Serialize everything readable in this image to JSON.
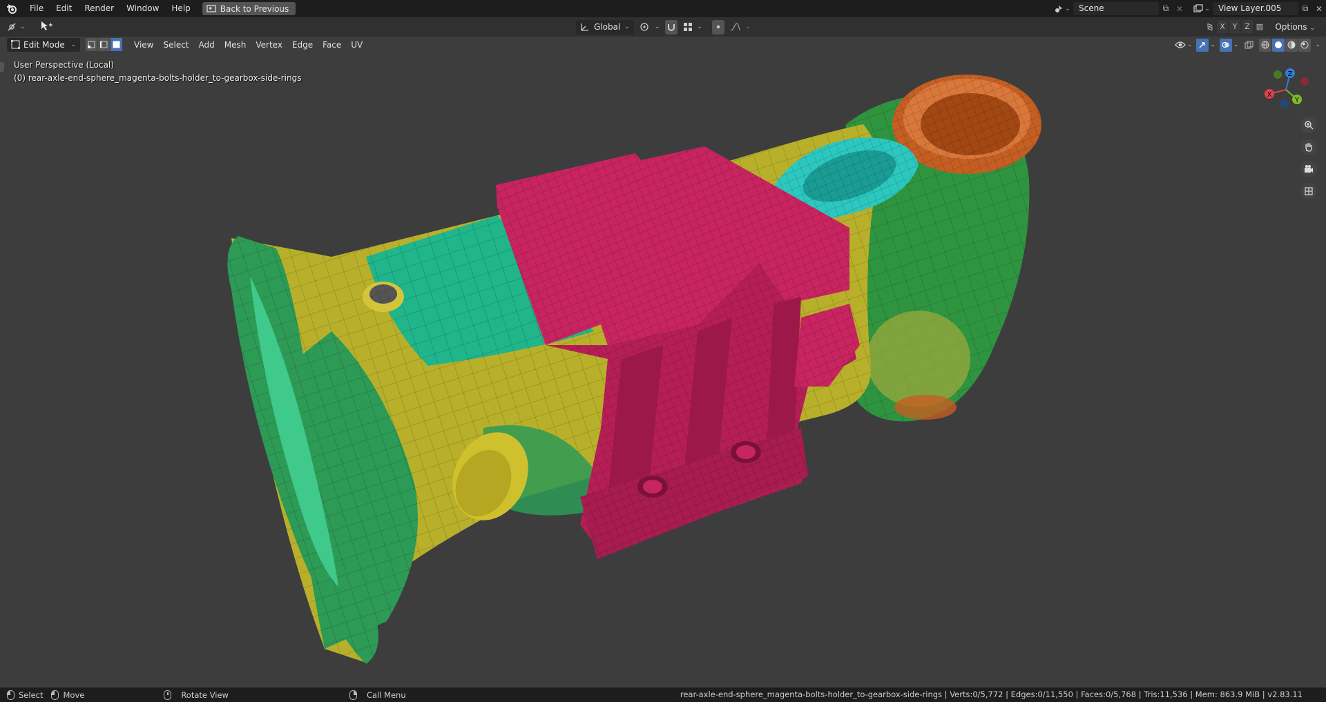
{
  "topbar": {
    "menus": [
      "File",
      "Edit",
      "Render",
      "Window",
      "Help"
    ],
    "back_label": "Back to Previous",
    "scene_name": "Scene",
    "view_layer": "View Layer.005"
  },
  "header2": {
    "transform_orientation": "Global",
    "axes": [
      "X",
      "Y",
      "Z"
    ],
    "options_label": "Options"
  },
  "header3": {
    "mode": "Edit Mode",
    "menus": [
      "View",
      "Select",
      "Add",
      "Mesh",
      "Vertex",
      "Edge",
      "Face",
      "UV"
    ],
    "select_mode_active": "face"
  },
  "viewport": {
    "perspective": "User Perspective (Local)",
    "object_line": "(0) rear-axle-end-sphere_magenta-bolts-holder_to-gearbox-side-rings",
    "gizmo_axes": [
      "X",
      "Y",
      "Z"
    ],
    "colors": {
      "green": "#2d9a56",
      "teal": "#20b58a",
      "yellow": "#b8b02a",
      "magenta": "#c8245f",
      "orange": "#c45e22",
      "cyan": "#2cc8c0"
    }
  },
  "statusbar": {
    "select": "Select",
    "move": "Move",
    "rotate": "Rotate View",
    "call_menu": "Call Menu",
    "stats": "rear-axle-end-sphere_magenta-bolts-holder_to-gearbox-side-rings | Verts:0/5,772 | Edges:0/11,550 | Faces:0/5,768 | Tris:11,536 | Mem: 863.9 MiB | v2.83.11"
  }
}
